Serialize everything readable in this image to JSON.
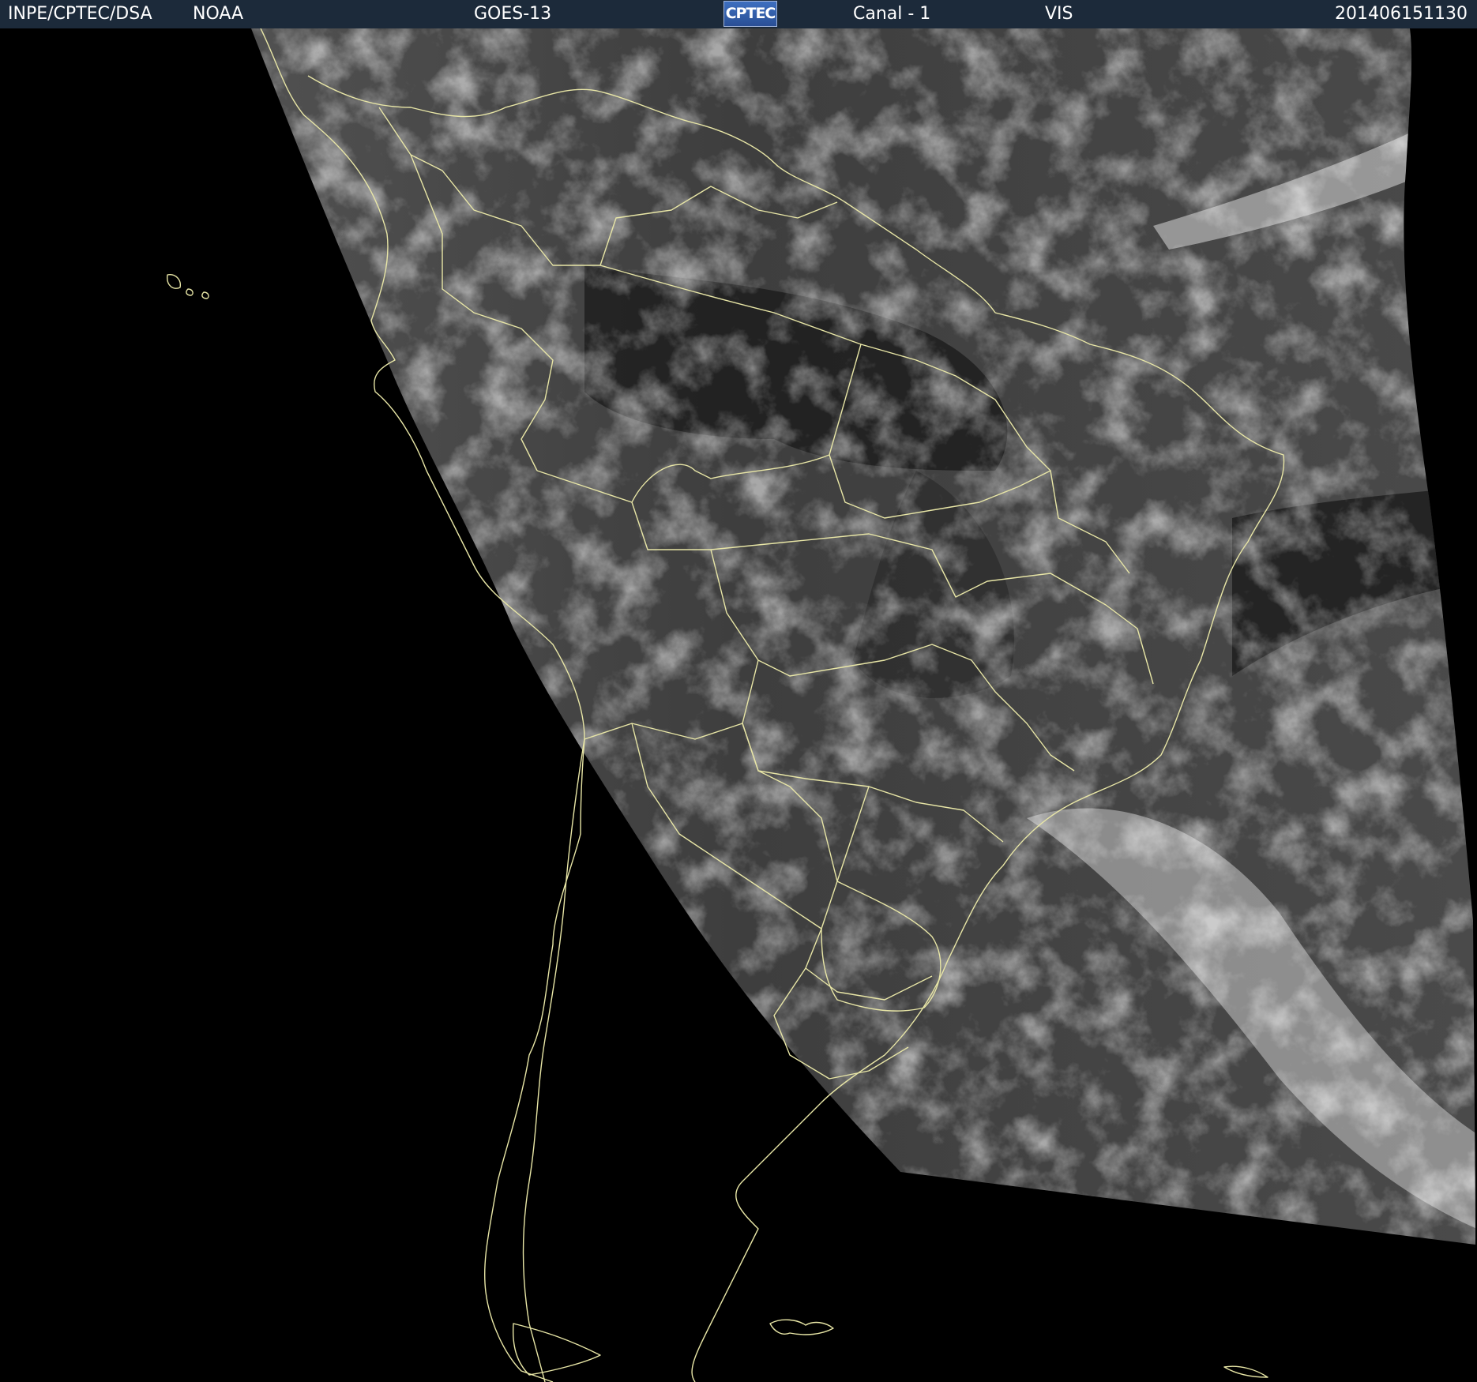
{
  "header": {
    "agency": "INPE/CPTEC/DSA",
    "provider": "NOAA",
    "satellite": "GOES-13",
    "logo_text": "CPTEC",
    "channel": "Canal - 1",
    "band": "VIS",
    "timestamp": "201406151130"
  },
  "colors": {
    "header_bg": "#1c2a3a",
    "borders": "#e8e6a6",
    "background": "#000000"
  }
}
